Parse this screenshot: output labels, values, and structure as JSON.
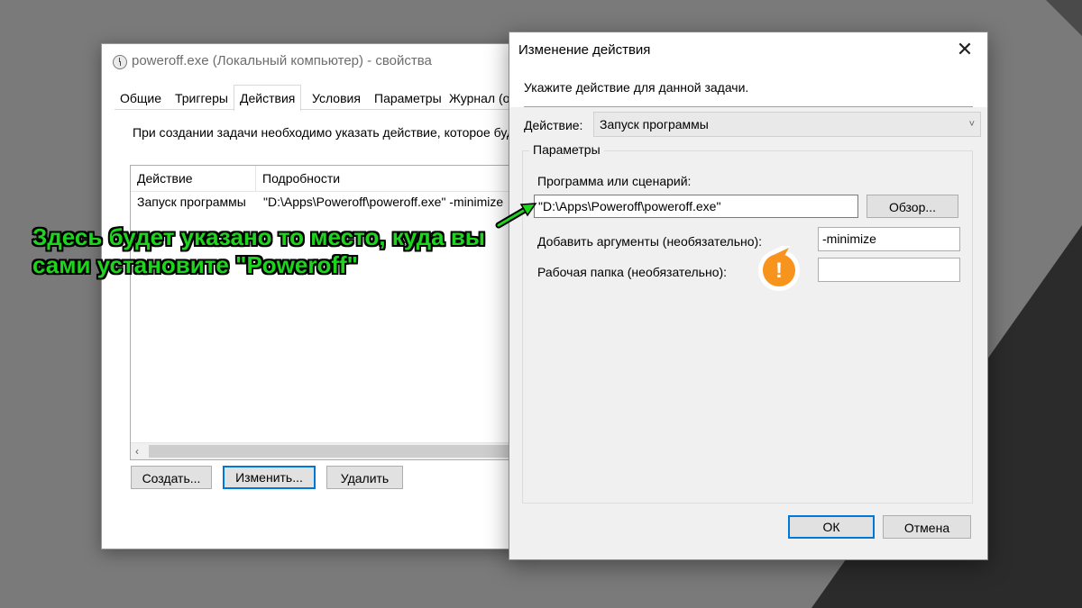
{
  "back_window": {
    "title": "poweroff.exe (Локальный компьютер) - свойства",
    "tabs": [
      {
        "label": "Общие"
      },
      {
        "label": "Триггеры"
      },
      {
        "label": "Действия"
      },
      {
        "label": "Условия"
      },
      {
        "label": "Параметры"
      },
      {
        "label": "Журнал (о"
      }
    ],
    "active_tab": "Действия",
    "intro_text": "При создании задачи необходимо указать действие, которое буд",
    "list": {
      "columns": [
        "Действие",
        "Подробности"
      ],
      "rows": [
        {
          "action": "Запуск программы",
          "details": "\"D:\\Apps\\Poweroff\\poweroff.exe\" -minimize"
        }
      ],
      "scroll_left_arrow": "‹"
    },
    "buttons": {
      "create": "Создать...",
      "edit": "Изменить...",
      "delete": "Удалить"
    }
  },
  "edit_dialog": {
    "title": "Изменение действия",
    "close_glyph": "✕",
    "heading": "Укажите действие для данной задачи.",
    "action_label": "Действие:",
    "action_value": "Запуск программы",
    "combo_chevron": "˅",
    "group_title": "Параметры",
    "program_label": "Программа или сценарий:",
    "program_value": "\"D:\\Apps\\Poweroff\\poweroff.exe\"",
    "browse_button": "Обзор...",
    "args_label": "Добавить аргументы (необязательно):",
    "args_value": "-minimize",
    "workdir_label": "Рабочая папка (необязательно):",
    "workdir_value": "",
    "ok_button": "ОК",
    "cancel_button": "Отмена"
  },
  "annotation": {
    "line1": "Здесь будет указано то место, куда вы",
    "line2": "сами установите \"Poweroff\"",
    "text_color": "#1ed51e",
    "badge_glyph": "!",
    "badge_color": "#f7941d"
  }
}
